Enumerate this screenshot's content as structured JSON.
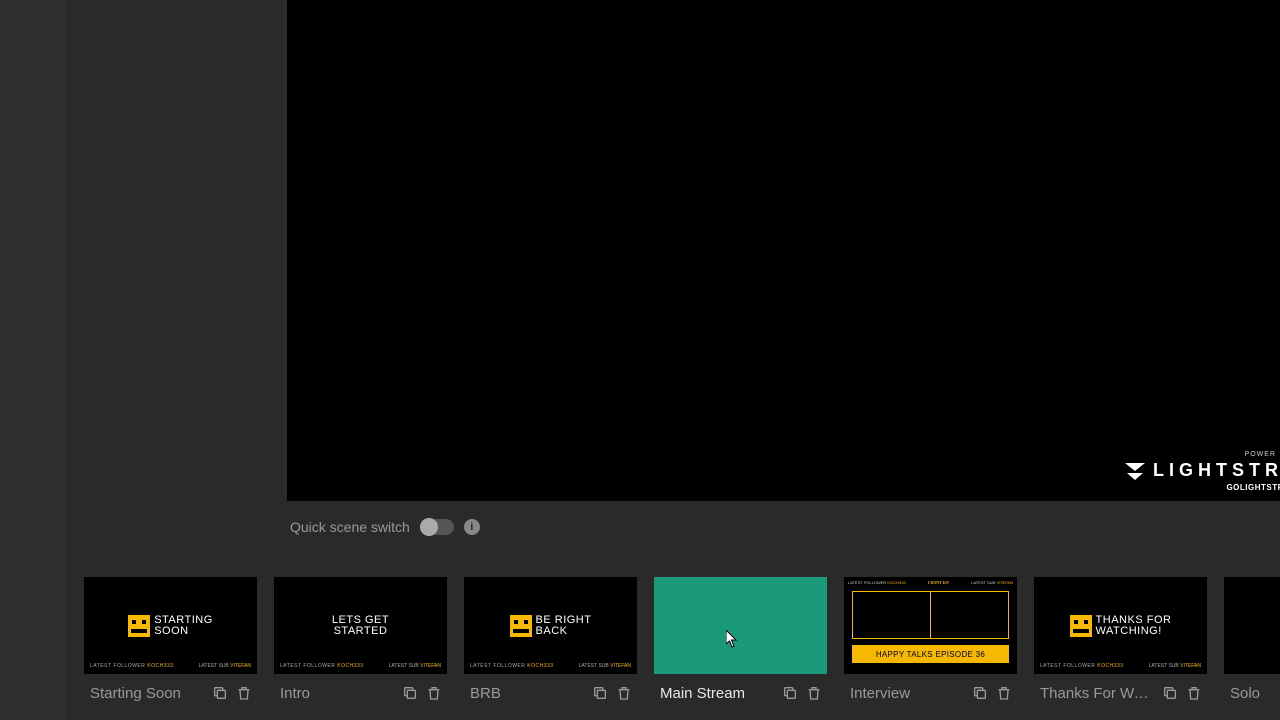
{
  "preview": {
    "bug_small": "POWER",
    "bug_title": "LIGHTSTRE",
    "bug_sub": "GOLIGHTSTREA"
  },
  "qss": {
    "label": "Quick scene switch"
  },
  "scenes": [
    {
      "label": "Starting Soon",
      "thumb_kind": "logo_text",
      "thumb_text": "STARTING\nSOON"
    },
    {
      "label": "Intro",
      "thumb_kind": "text_only",
      "thumb_text": "LETS GET\nSTARTED"
    },
    {
      "label": "BRB",
      "thumb_kind": "logo_text",
      "thumb_text": "BE RIGHT\nBACK"
    },
    {
      "label": "Main Stream",
      "thumb_kind": "teal",
      "active": true
    },
    {
      "label": "Interview",
      "thumb_kind": "interview",
      "banner": "HAPPY TALKS EPISODE 36"
    },
    {
      "label": "Thanks For Wa…",
      "thumb_kind": "logo_text",
      "thumb_text": "THANKS FOR\nWATCHING!"
    },
    {
      "label": "Solo",
      "thumb_kind": "black"
    }
  ],
  "footer_left": "LATEST FOLLOWER",
  "footer_left_hl": "KOCH333",
  "footer_right": "LATEST SUB",
  "footer_right_hl": "VITEFAN"
}
